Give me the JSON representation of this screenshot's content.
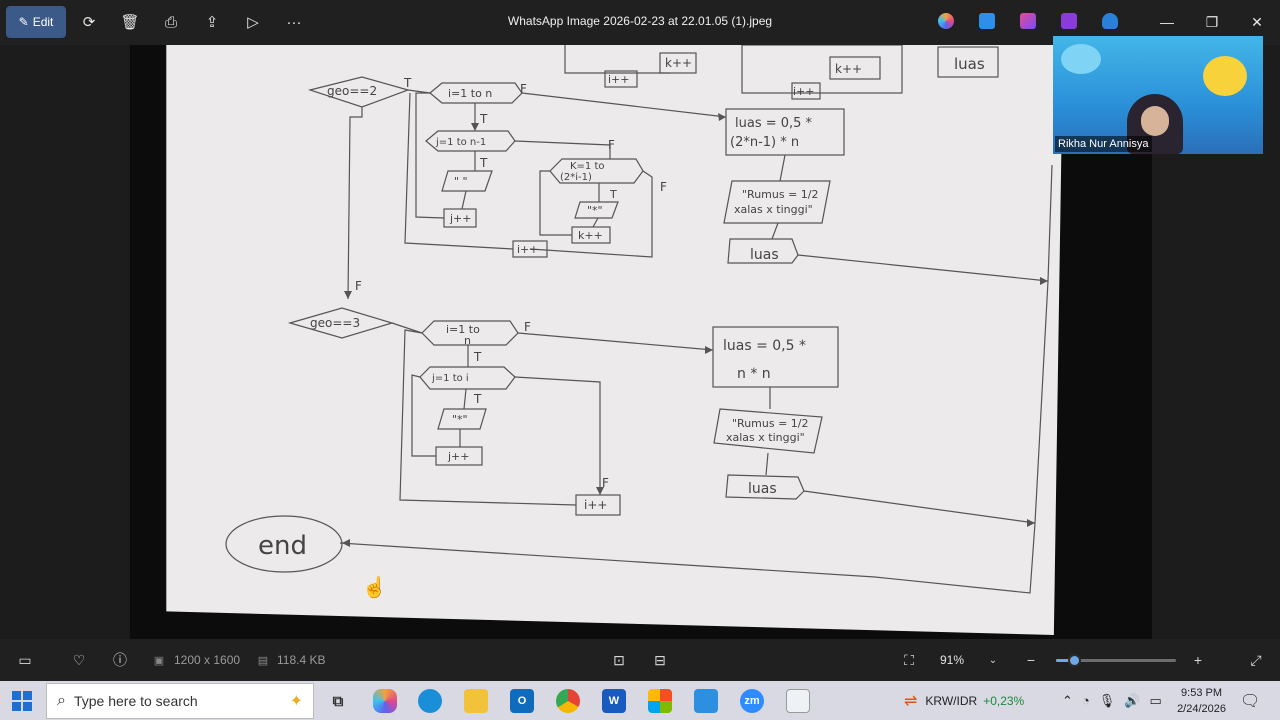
{
  "window": {
    "title": "WhatsApp Image 2026-02-23 at 22.01.05 (1).jpeg"
  },
  "toolbar": {
    "edit_label": "Edit",
    "more_label": "···"
  },
  "flowchart": {
    "top_partial": [
      "i++",
      "k++",
      "k++",
      "i++",
      "luas"
    ],
    "section1": {
      "decision": "geo==2",
      "loop_i": "i=1 to n",
      "loop_j": "j=1 to n-1",
      "print_space": "\" \"",
      "j_inc": "j++",
      "loop_k_line1": "K=1 to",
      "loop_k_line2": "(2*i-1)",
      "print_star": "\"*\"",
      "k_inc": "k++",
      "i_inc": "i++",
      "formula_line1": "luas = 0,5 *",
      "formula_line2": "(2*n-1) * n",
      "rumus_line1": "\"Rumus = 1/2",
      "rumus_line2": "xalas x tinggi\"",
      "output": "luas"
    },
    "section2": {
      "decision": "geo==3",
      "loop_i_line1": "i=1 to",
      "loop_i_line2": "n",
      "loop_j": "j=1 to i",
      "print_star": "\"*\"",
      "j_inc": "j++",
      "i_inc": "i++",
      "formula_line1": "luas = 0,5 *",
      "formula_line2": "n * n",
      "rumus_line1": "\"Rumus = 1/2",
      "rumus_line2": "xalas x tinggi\"",
      "output": "luas"
    },
    "end_label": "end",
    "true_label": "T",
    "false_label": "F"
  },
  "video": {
    "participant_name": "Rikha Nur Annisya"
  },
  "statusbar": {
    "dimensions": "1200 x 1600",
    "file_size": "118.4 KB",
    "zoom": "91%",
    "zoom_fraction": 0.15
  },
  "taskbar": {
    "search_placeholder": "Type here to search",
    "currency_label": "KRW/IDR",
    "currency_change": "+0,23%",
    "time": "9:53 PM",
    "date": "2/24/2026",
    "zoom_app": "zm"
  }
}
